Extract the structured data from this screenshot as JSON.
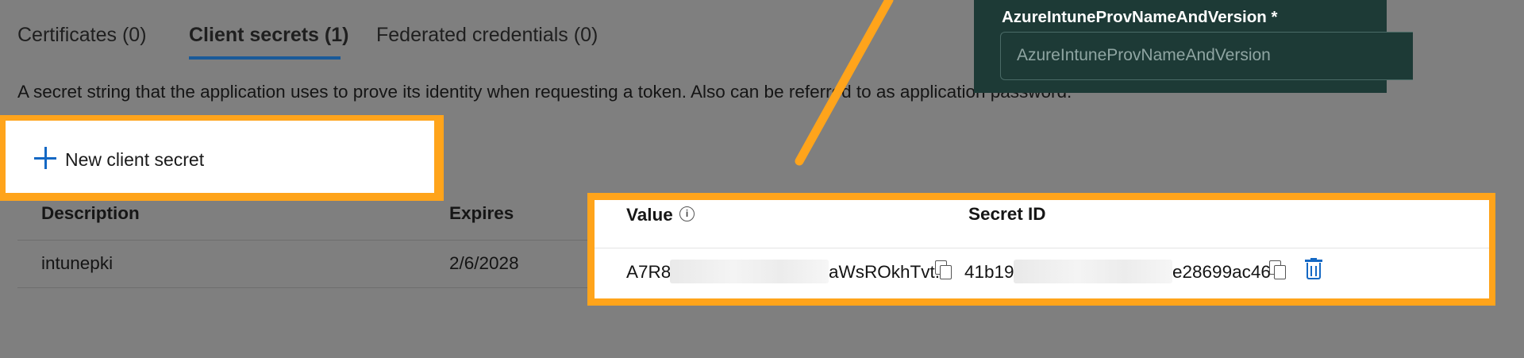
{
  "tabs": [
    {
      "label": "Certificates (0)",
      "active": false
    },
    {
      "label": "Client secrets (1)",
      "active": true
    },
    {
      "label": "Federated credentials (0)",
      "active": false
    }
  ],
  "description": "A secret string that the application uses to prove its identity when requesting a token. Also can be referred to as application password.",
  "new_secret_button": {
    "label": "New client secret",
    "icon": "plus-icon"
  },
  "table": {
    "headers": {
      "description": "Description",
      "expires": "Expires",
      "value": "Value",
      "secret_id": "Secret ID"
    },
    "rows": [
      {
        "description": "intunepki",
        "expires": "2/6/2028",
        "value_prefix": "A7R8",
        "value_suffix": "aWsROkhTvt...",
        "secret_id_prefix": "41b19",
        "secret_id_suffix": "e28699ac467"
      }
    ]
  },
  "icons": {
    "info": "info-icon",
    "copy": "copy-icon",
    "delete": "trash-icon"
  },
  "popup": {
    "field_label": "AzureIntuneProvNameAndVersion *",
    "field_placeholder": "AzureIntuneProvNameAndVersion"
  },
  "colors": {
    "highlight": "#ffa41b",
    "accent": "#1468c4",
    "tab_underline": "#1a5a99",
    "popup_bg": "#1d3a36",
    "backdrop": "#7f7f7f"
  }
}
